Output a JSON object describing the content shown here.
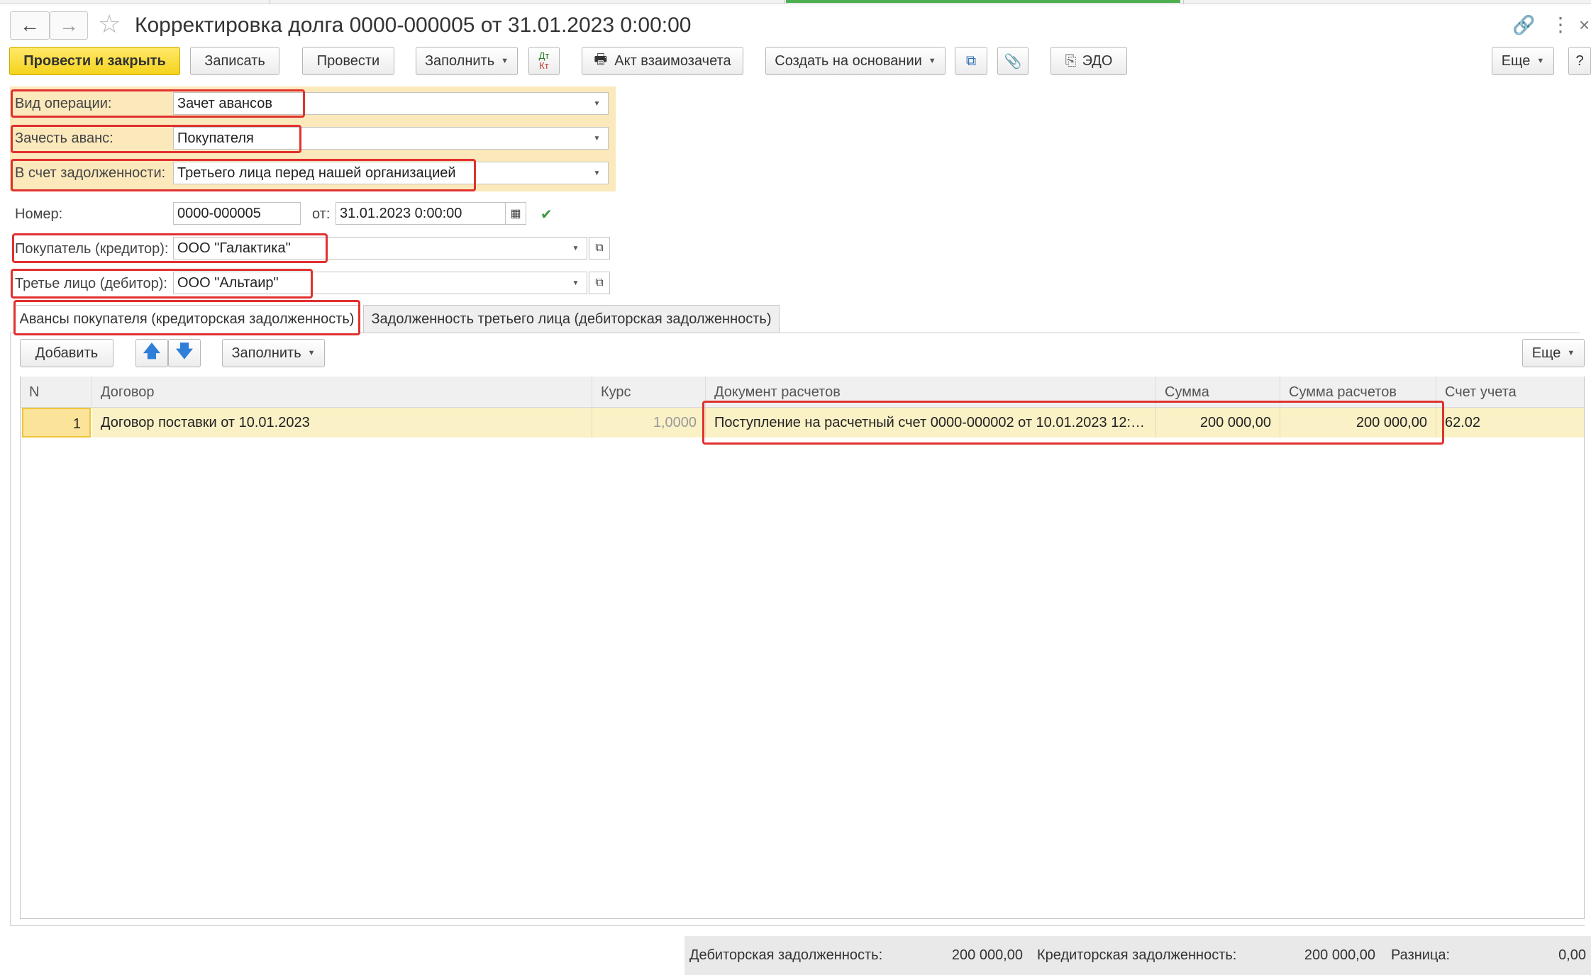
{
  "window": {
    "title": "Корректировка долга 0000-000005 от 31.01.2023 0:00:00"
  },
  "toolbar": {
    "post_close": "Провести и закрыть",
    "save": "Записать",
    "post": "Провести",
    "fill": "Заполнить",
    "dtkt_top": "Дт",
    "dtkt_bottom": "Кт",
    "act": "Акт взаимозачета",
    "create_based": "Создать на основании",
    "edo": "ЭДО",
    "more": "Еще",
    "help": "?"
  },
  "form": {
    "operation_label": "Вид операции:",
    "operation_value": "Зачет авансов",
    "offset_label": "Зачесть аванс:",
    "offset_value": "Покупателя",
    "debt_label": "В счет задолженности:",
    "debt_value": "Третьего лица перед нашей организацией",
    "number_label": "Номер:",
    "number_value": "0000-000005",
    "date_label": "от:",
    "date_value": "31.01.2023  0:00:00",
    "buyer_label": "Покупатель (кредитор):",
    "buyer_value": "ООО \"Галактика\"",
    "third_label": "Третье лицо (дебитор):",
    "third_value": "ООО \"Альтаир\""
  },
  "tabs": [
    {
      "label": "Авансы покупателя (кредиторская задолженность)",
      "active": true
    },
    {
      "label": "Задолженность третьего лица (дебиторская задолженность)",
      "active": false
    }
  ],
  "table_toolbar": {
    "add": "Добавить",
    "fill": "Заполнить",
    "more": "Еще"
  },
  "table": {
    "columns": [
      "N",
      "Договор",
      "Курс",
      "Документ расчетов",
      "Сумма",
      "Сумма расчетов",
      "Счет учета"
    ],
    "rows": [
      [
        "1",
        "Договор поставки от 10.01.2023",
        "1,0000",
        "Поступление на расчетный счет 0000-000002 от 10.01.2023 12:0...",
        "200 000,00",
        "200 000,00",
        "62.02"
      ]
    ]
  },
  "footer": {
    "debit_label": "Дебиторская задолженность:",
    "debit_value": "200 000,00",
    "credit_label": "Кредиторская задолженность:",
    "credit_value": "200 000,00",
    "diff_label": "Разница:",
    "diff_value": "0,00"
  }
}
